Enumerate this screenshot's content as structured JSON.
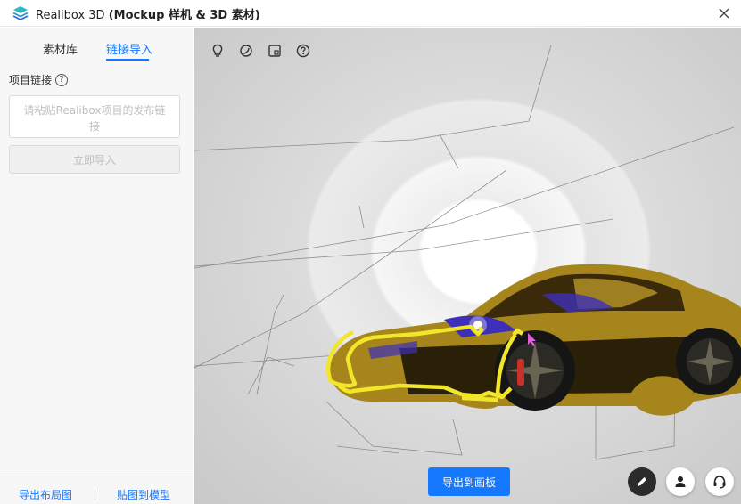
{
  "window": {
    "app_name": "Realibox 3D",
    "subtitle": "(Mockup 样机 & 3D 素材)"
  },
  "left_panel": {
    "tabs": [
      {
        "label": "素材库",
        "active": false
      },
      {
        "label": "链接导入",
        "active": true
      }
    ],
    "link_field_label": "项目链接",
    "link_input": {
      "value": "",
      "placeholder": "请粘贴Realibox项目的发布链接"
    },
    "import_button": "立即导入",
    "bottom_links": [
      "导出布局图",
      "贴图到模型"
    ]
  },
  "viewport": {
    "tools": [
      "lightbulb-icon",
      "material-icon",
      "layout-icon",
      "help-icon"
    ],
    "export_button": "导出到画板",
    "corner_buttons": [
      "pen-icon",
      "user-icon",
      "headset-icon"
    ]
  },
  "colors": {
    "accent": "#1677ff",
    "highlight_outline": "#f2e62a",
    "car_body": "#b08a1c"
  }
}
